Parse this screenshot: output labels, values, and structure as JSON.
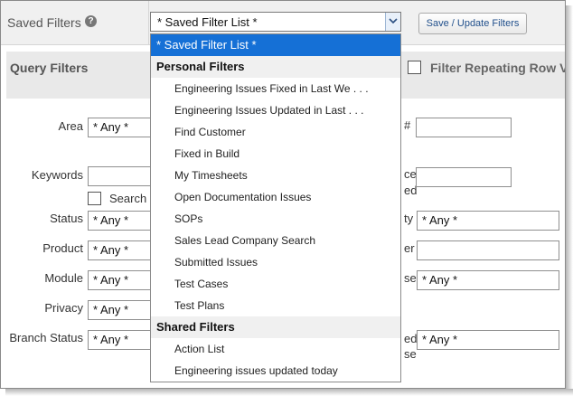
{
  "header": {
    "saved_filters_label": "Saved Filters",
    "help_icon_glyph": "?",
    "selected_value": "* Saved Filter List *",
    "save_button_label": "Save / Update Filters"
  },
  "query_filters": {
    "title": "Query Filters",
    "repeat_label": "Filter Repeating Row V"
  },
  "form": {
    "area_label": "Area",
    "area_value": "* Any *",
    "keywords_label": "Keywords",
    "search_label": "Search",
    "status_label": "Status",
    "status_value": "* Any *",
    "product_label": "Product",
    "product_value": "* Any *",
    "module_label": "Module",
    "module_value": "* Any *",
    "privacy_label": "Privacy",
    "privacy_value": "* Any *",
    "branch_status_label": "Branch Status",
    "branch_status_value": "* Any *",
    "right_hash_label": "#",
    "right_ce_label": "ce",
    "right_ed_label": "ed",
    "right_ty_label": "ty",
    "right_ty_value": "* Any *",
    "right_er_label": "er",
    "right_se_label": "se",
    "right_se_value": "* Any *",
    "right_ed2_label": "ed",
    "right_se2_label": "se",
    "right_ed2_value": "* Any *"
  },
  "dropdown": {
    "selected": "* Saved Filter List *",
    "groups": [
      {
        "label": "Personal Filters",
        "items": [
          "Engineering Issues Fixed in Last We . . .",
          "Engineering Issues Updated in Last . . .",
          "Find Customer",
          "Fixed in Build",
          "My Timesheets",
          "Open Documentation Issues",
          "SOPs",
          "Sales Lead Company Search",
          "Submitted Issues",
          "Test Cases",
          "Test Plans"
        ]
      },
      {
        "label": "Shared Filters",
        "items": [
          "Action List",
          "Engineering issues updated today"
        ]
      }
    ]
  },
  "colors": {
    "selection_blue": "#1570d6",
    "button_text": "#1f4e8a"
  }
}
